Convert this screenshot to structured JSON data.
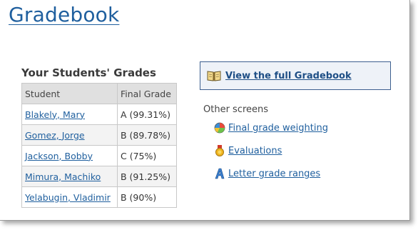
{
  "page": {
    "title": "Gradebook"
  },
  "grades": {
    "title": "Your Students' Grades",
    "columns": [
      "Student",
      "Final Grade"
    ],
    "rows": [
      {
        "student": "Blakely, Mary",
        "grade": "A (99.31%)"
      },
      {
        "student": "Gomez, Jorge",
        "grade": "B (89.78%)"
      },
      {
        "student": "Jackson, Bobby",
        "grade": "C (75%)"
      },
      {
        "student": "Mimura, Machiko",
        "grade": "B (91.25%)"
      },
      {
        "student": "Yelabugin, Vladimir",
        "grade": "B (90%)"
      }
    ]
  },
  "full_gradebook": {
    "label": "View the full Gradebook",
    "icon": "book-icon"
  },
  "other_screens": {
    "title": "Other screens",
    "links": [
      {
        "label": "Final grade weighting",
        "icon": "pie-chart-icon"
      },
      {
        "label": "Evaluations",
        "icon": "medal-icon"
      },
      {
        "label": "Letter grade ranges",
        "icon": "letter-a-icon"
      }
    ]
  },
  "colors": {
    "link": "#1f5f9e",
    "box_border": "#3d5f8f",
    "box_bg": "#eef2f8"
  }
}
